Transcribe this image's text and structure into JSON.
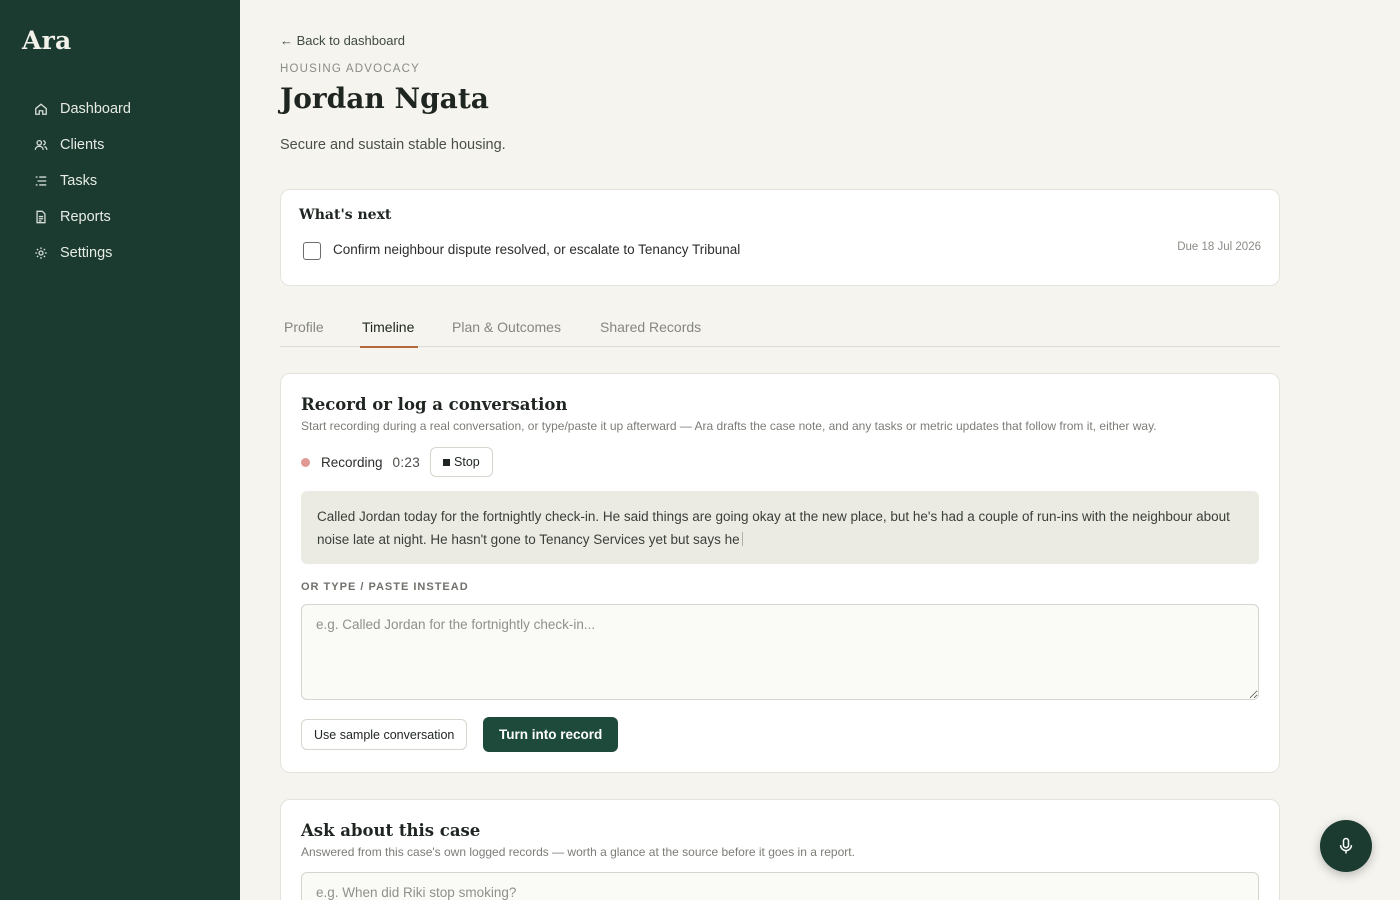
{
  "sidebar": {
    "brand": "Ara",
    "items": [
      {
        "label": "Dashboard",
        "icon": "home-icon"
      },
      {
        "label": "Clients",
        "icon": "users-icon"
      },
      {
        "label": "Tasks",
        "icon": "list-icon"
      },
      {
        "label": "Reports",
        "icon": "document-icon"
      },
      {
        "label": "Settings",
        "icon": "gear-icon"
      }
    ]
  },
  "header": {
    "back_label": "← Back to dashboard",
    "eyebrow": "HOUSING ADVOCACY",
    "title": "Jordan Ngata",
    "subtitle": "Secure and sustain stable housing."
  },
  "whats_next": {
    "heading": "What's next",
    "task": "Confirm neighbour dispute resolved, or escalate to Tenancy Tribunal",
    "due": "Due 18 Jul 2026",
    "checked": false
  },
  "tabs": [
    {
      "label": "Profile",
      "active": false
    },
    {
      "label": "Timeline",
      "active": true
    },
    {
      "label": "Plan & Outcomes",
      "active": false
    },
    {
      "label": "Shared Records",
      "active": false
    }
  ],
  "record": {
    "heading": "Record or log a conversation",
    "description": "Start recording during a real conversation, or type/paste it up afterward — Ara drafts the case note, and any tasks or metric updates that follow from it, either way.",
    "status_label": "Recording",
    "timer": "0:23",
    "stop_label": "Stop",
    "transcript": "Called Jordan today for the fortnightly check-in. He said things are going okay at the new place, but he's had a couple of run-ins with the neighbour about noise late at night. He hasn't gone to Tenancy Services yet but says he",
    "or_label": "OR TYPE / PASTE INSTEAD",
    "type_placeholder": "e.g. Called Jordan for the fortnightly check-in...",
    "sample_button": "Use sample conversation",
    "submit_button": "Turn into record"
  },
  "ask": {
    "heading": "Ask about this case",
    "description": "Answered from this case's own logged records — worth a glance at the source before it goes in a report.",
    "placeholder": "e.g. When did Riki stop smoking?"
  },
  "colors": {
    "sidebar_bg": "#1b3a30",
    "accent": "#1d4a3b",
    "tab_underline": "#b36a3a",
    "recording_dot": "#e09a93"
  },
  "fab_icon": "microphone-icon"
}
